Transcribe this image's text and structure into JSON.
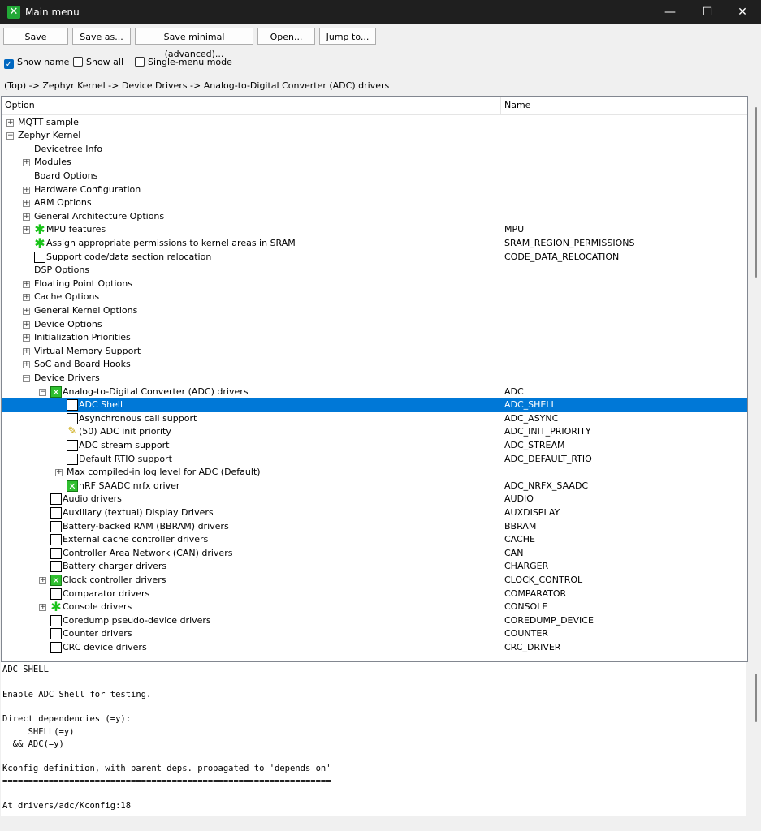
{
  "window": {
    "title": "Main menu",
    "icon": "app-x-icon",
    "accent": "#21a936"
  },
  "toolbar": {
    "save": "Save",
    "save_as": "Save as...",
    "save_minimal": "Save minimal (advanced)...",
    "open": "Open...",
    "jump_to": "Jump to..."
  },
  "options": {
    "show_name": "Show name",
    "show_all": "Show all",
    "single_menu": "Single-menu mode",
    "show_name_checked": true,
    "show_all_checked": false,
    "single_menu_checked": false
  },
  "breadcrumb": "(Top) -> Zephyr Kernel -> Device Drivers -> Analog-to-Digital Converter (ADC) drivers",
  "tree": {
    "headers": {
      "option": "Option",
      "name": "Name"
    },
    "rows": [
      {
        "label": "MQTT sample",
        "name": "",
        "expander": "+",
        "indicator": "",
        "level": 0
      },
      {
        "label": "Zephyr Kernel",
        "name": "",
        "expander": "-",
        "indicator": "",
        "level": 0
      },
      {
        "label": "Devicetree Info",
        "name": "",
        "expander": "",
        "indicator": "",
        "level": 1
      },
      {
        "label": "Modules",
        "name": "",
        "expander": "+",
        "indicator": "",
        "level": 1
      },
      {
        "label": "Board Options",
        "name": "",
        "expander": "",
        "indicator": "",
        "level": 1
      },
      {
        "label": "Hardware Configuration",
        "name": "",
        "expander": "+",
        "indicator": "",
        "level": 1
      },
      {
        "label": "ARM Options",
        "name": "",
        "expander": "+",
        "indicator": "",
        "level": 1
      },
      {
        "label": "General Architecture Options",
        "name": "",
        "expander": "+",
        "indicator": "",
        "level": 1
      },
      {
        "label": "MPU features",
        "name": "MPU",
        "expander": "+",
        "indicator": "mod",
        "level": 1
      },
      {
        "label": "Assign appropriate permissions to kernel areas in SRAM",
        "name": "SRAM_REGION_PERMISSIONS",
        "expander": "",
        "indicator": "mod",
        "level": 1
      },
      {
        "label": "Support code/data section relocation",
        "name": "CODE_DATA_RELOCATION",
        "expander": "",
        "indicator": "box",
        "level": 1
      },
      {
        "label": "DSP Options",
        "name": "",
        "expander": "",
        "indicator": "",
        "level": 1
      },
      {
        "label": "Floating Point Options",
        "name": "",
        "expander": "+",
        "indicator": "",
        "level": 1
      },
      {
        "label": "Cache Options",
        "name": "",
        "expander": "+",
        "indicator": "",
        "level": 1
      },
      {
        "label": "General Kernel Options",
        "name": "",
        "expander": "+",
        "indicator": "",
        "level": 1
      },
      {
        "label": "Device Options",
        "name": "",
        "expander": "+",
        "indicator": "",
        "level": 1
      },
      {
        "label": "Initialization Priorities",
        "name": "",
        "expander": "+",
        "indicator": "",
        "level": 1
      },
      {
        "label": "Virtual Memory Support",
        "name": "",
        "expander": "+",
        "indicator": "",
        "level": 1
      },
      {
        "label": "SoC and Board Hooks",
        "name": "",
        "expander": "+",
        "indicator": "",
        "level": 1
      },
      {
        "label": "Device Drivers",
        "name": "",
        "expander": "-",
        "indicator": "",
        "level": 1
      },
      {
        "label": "Analog-to-Digital Converter (ADC) drivers",
        "name": "ADC",
        "expander": "-",
        "indicator": "yes",
        "level": 2
      },
      {
        "label": "ADC Shell",
        "name": "ADC_SHELL",
        "expander": "",
        "indicator": "box",
        "level": 3,
        "selected": true
      },
      {
        "label": "Asynchronous call support",
        "name": "ADC_ASYNC",
        "expander": "",
        "indicator": "box",
        "level": 3
      },
      {
        "label": "(50) ADC init priority",
        "name": "ADC_INIT_PRIORITY",
        "expander": "",
        "indicator": "pen",
        "level": 3
      },
      {
        "label": "ADC stream support",
        "name": "ADC_STREAM",
        "expander": "",
        "indicator": "box",
        "level": 3
      },
      {
        "label": "Default RTIO support",
        "name": "ADC_DEFAULT_RTIO",
        "expander": "",
        "indicator": "box",
        "level": 3
      },
      {
        "label": "Max compiled-in log level for ADC (Default)",
        "name": "",
        "expander": "+",
        "indicator": "",
        "level": 3
      },
      {
        "label": "nRF SAADC nrfx driver",
        "name": "ADC_NRFX_SAADC",
        "expander": "",
        "indicator": "yes",
        "level": 3
      },
      {
        "label": "Audio drivers",
        "name": "AUDIO",
        "expander": "",
        "indicator": "box",
        "level": 2
      },
      {
        "label": "Auxiliary (textual) Display Drivers",
        "name": "AUXDISPLAY",
        "expander": "",
        "indicator": "box",
        "level": 2
      },
      {
        "label": "Battery-backed RAM (BBRAM) drivers",
        "name": "BBRAM",
        "expander": "",
        "indicator": "box",
        "level": 2
      },
      {
        "label": "External cache controller drivers",
        "name": "CACHE",
        "expander": "",
        "indicator": "box",
        "level": 2
      },
      {
        "label": "Controller Area Network (CAN) drivers",
        "name": "CAN",
        "expander": "",
        "indicator": "box",
        "level": 2
      },
      {
        "label": "Battery charger drivers",
        "name": "CHARGER",
        "expander": "",
        "indicator": "box",
        "level": 2
      },
      {
        "label": "Clock controller drivers",
        "name": "CLOCK_CONTROL",
        "expander": "+",
        "indicator": "yes",
        "level": 2
      },
      {
        "label": "Comparator drivers",
        "name": "COMPARATOR",
        "expander": "",
        "indicator": "box",
        "level": 2
      },
      {
        "label": "Console drivers",
        "name": "CONSOLE",
        "expander": "+",
        "indicator": "mod",
        "level": 2
      },
      {
        "label": "Coredump pseudo-device drivers",
        "name": "COREDUMP_DEVICE",
        "expander": "",
        "indicator": "box",
        "level": 2
      },
      {
        "label": "Counter drivers",
        "name": "COUNTER",
        "expander": "",
        "indicator": "box",
        "level": 2
      },
      {
        "label": "CRC device drivers",
        "name": "CRC_DRIVER",
        "expander": "",
        "indicator": "box",
        "level": 2
      }
    ]
  },
  "description": {
    "lines": [
      "ADC_SHELL",
      "",
      "Enable ADC Shell for testing.",
      "",
      "Direct dependencies (=y):",
      "     SHELL(=y)",
      "  && ADC(=y)",
      "",
      "Kconfig definition, with parent deps. propagated to 'depends on'",
      "================================================================",
      "",
      "At drivers/adc/Kconfig:18"
    ]
  }
}
